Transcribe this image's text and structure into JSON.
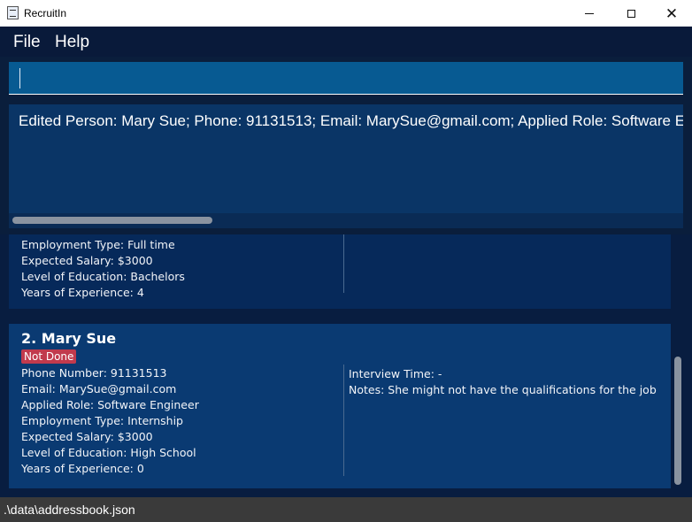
{
  "window": {
    "title": "RecruitIn",
    "icon": "app-document-icon"
  },
  "menu": {
    "file": "File",
    "help": "Help"
  },
  "command_box": {
    "value": "",
    "placeholder": ""
  },
  "result": {
    "text": "Edited Person: Mary Sue; Phone: 91131513; Email: MarySue@gmail.com; Applied Role: Software E"
  },
  "list": {
    "previous_card": {
      "lines": [
        "Employment Type: Full time",
        "Expected Salary: $3000",
        "Level of Education: Bachelors",
        "Years of Experience: 4"
      ]
    },
    "current_card": {
      "title": "2.  Mary Sue",
      "status": "Not Done",
      "status_color": "#c13a4d",
      "lines": [
        "Phone Number: 91131513",
        "Email: MarySue@gmail.com",
        "Applied Role: Software Engineer",
        "Employment Type: Internship",
        "Expected Salary: $3000",
        "Level of Education: High School",
        "Years of Experience: 0"
      ],
      "right_lines": [
        "Interview Time: -",
        "Notes: She might not have the qualifications for the job"
      ]
    }
  },
  "status_bar": {
    "path": ".\\data\\addressbook.json"
  }
}
